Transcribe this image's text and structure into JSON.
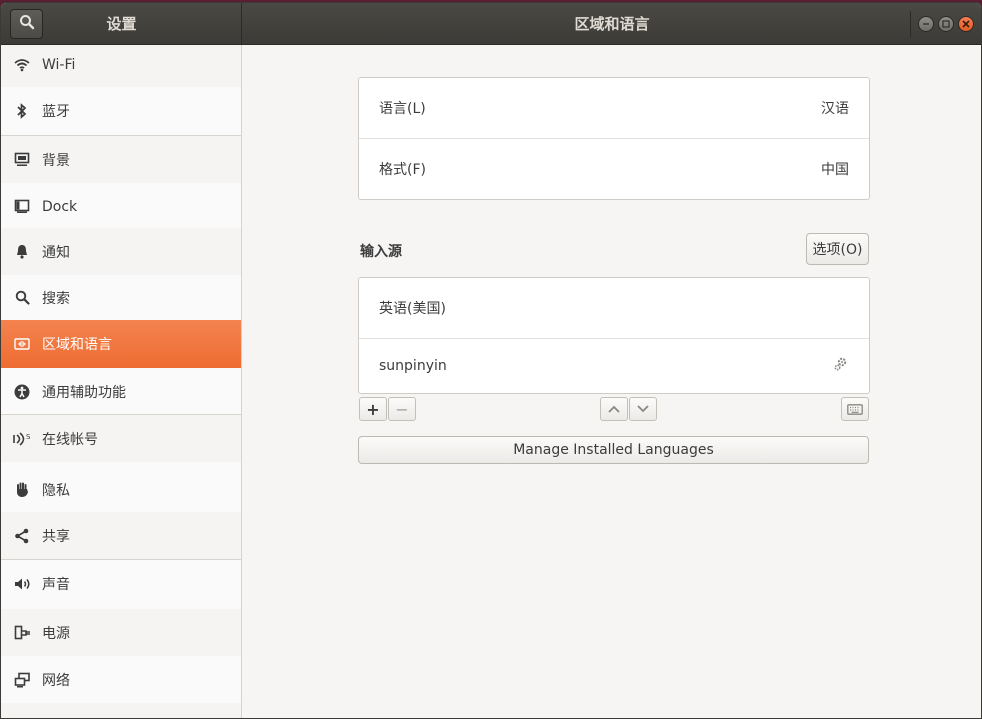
{
  "header": {
    "sidebar_title": "设置",
    "page_title": "区域和语言"
  },
  "sidebar": {
    "items": [
      {
        "label": "Wi-Fi",
        "icon": "wifi-icon"
      },
      {
        "label": "蓝牙",
        "icon": "bluetooth-icon"
      },
      {
        "label": "背景",
        "icon": "background-icon"
      },
      {
        "label": "Dock",
        "icon": "dock-icon"
      },
      {
        "label": "通知",
        "icon": "bell-icon"
      },
      {
        "label": "搜索",
        "icon": "search-icon"
      },
      {
        "label": "区域和语言",
        "icon": "flag-icon",
        "active": true
      },
      {
        "label": "通用辅助功能",
        "icon": "accessibility-icon"
      },
      {
        "label": "在线帐号",
        "icon": "online-accounts-icon"
      },
      {
        "label": "隐私",
        "icon": "hand-icon"
      },
      {
        "label": "共享",
        "icon": "share-icon"
      },
      {
        "label": "声音",
        "icon": "speaker-icon"
      },
      {
        "label": "电源",
        "icon": "power-plug-icon"
      },
      {
        "label": "网络",
        "icon": "network-icon"
      }
    ]
  },
  "region": {
    "language_label": "语言(L)",
    "language_value": "汉语",
    "formats_label": "格式(F)",
    "formats_value": "中国"
  },
  "input_sources": {
    "section_label": "输入源",
    "options_button": "选项(O)",
    "sources": [
      "英语(美国)",
      "sunpinyin"
    ],
    "add_label": "+",
    "remove_label": "−"
  },
  "manage_button": "Manage Installed Languages",
  "colors": {
    "accent": "#ef703a",
    "headerbar": "#3c3b37"
  }
}
